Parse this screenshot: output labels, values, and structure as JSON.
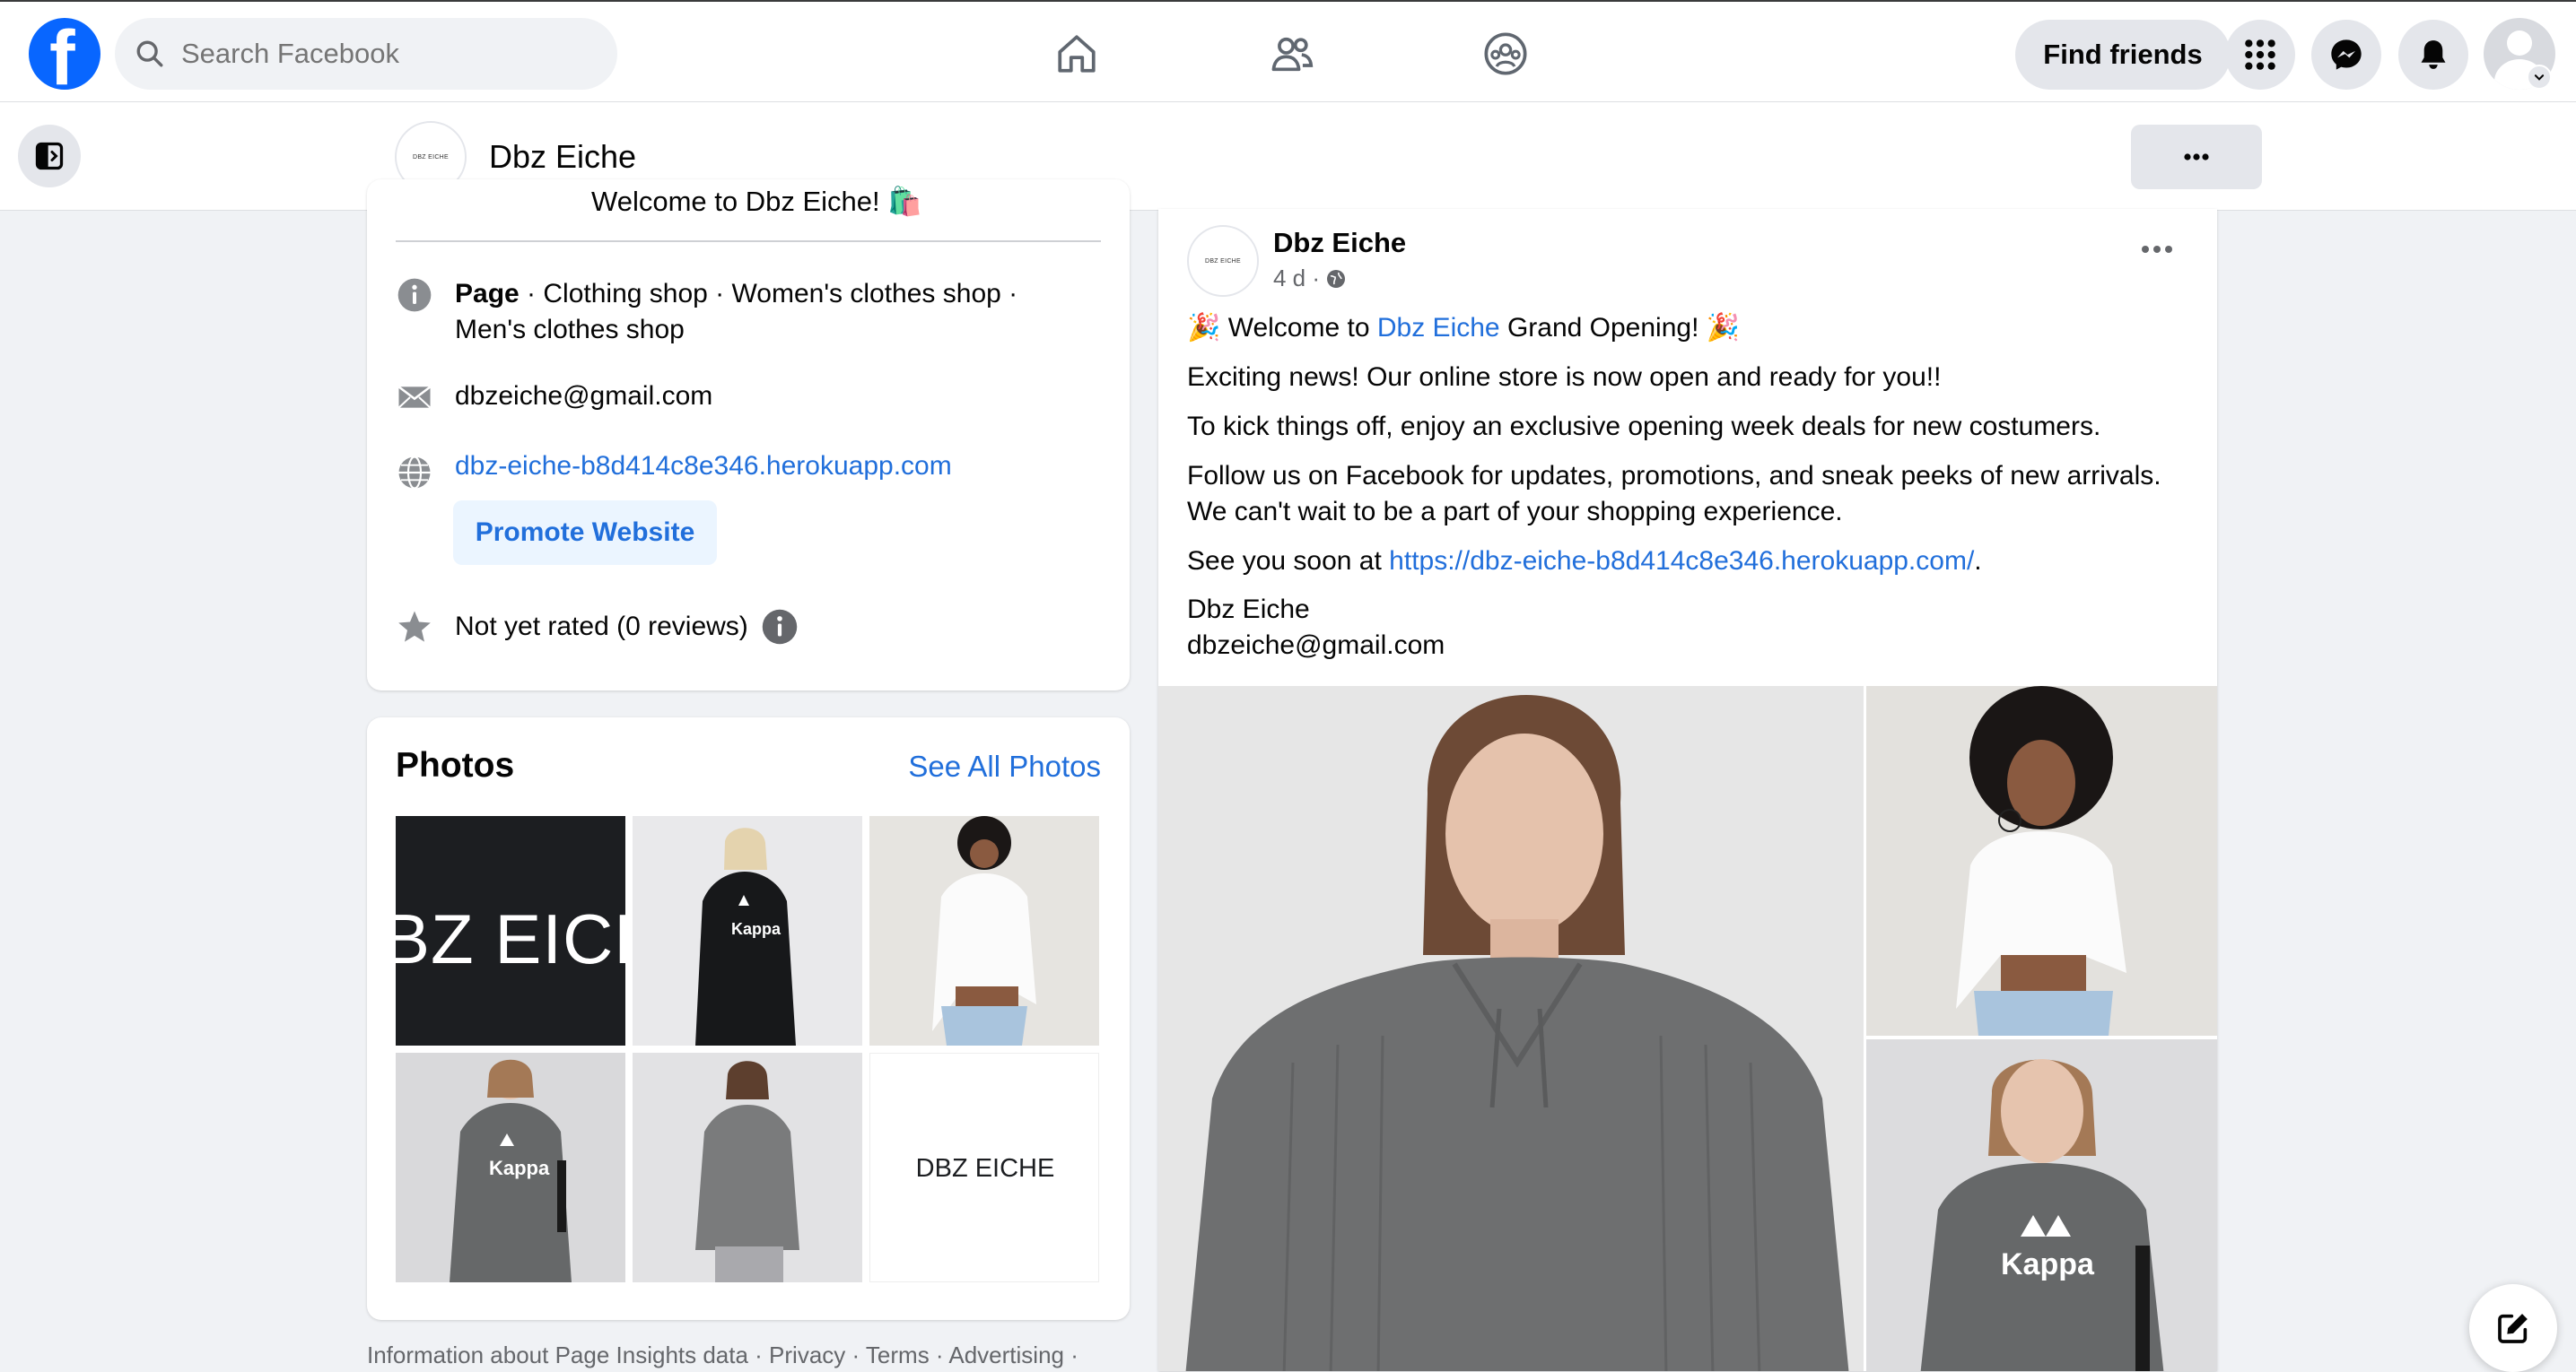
{
  "topnav": {
    "search_placeholder": "Search Facebook",
    "find_friends_label": "Find friends",
    "brand_color": "#0866ff"
  },
  "pagebar": {
    "page_name": "Dbz Eiche",
    "avatar_logo_text": "DBZ EICHE"
  },
  "intro": {
    "clipped_text": "Welcome to Dbz Eiche! 🛍️",
    "category_label": "Page",
    "categories_line1": " · Clothing shop · Women's clothes shop ·",
    "categories_line2": "Men's clothes shop",
    "email": "dbzeiche@gmail.com",
    "website": "dbz-eiche-b8d414c8e346.herokuapp.com",
    "promote_label": "Promote Website",
    "rating": "Not yet rated (0 reviews)"
  },
  "photos": {
    "title": "Photos",
    "see_all": "See All Photos",
    "logo_tile_text": "BZ EICH",
    "logo_tile2_text": "DBZ EICHE"
  },
  "footer": {
    "links": "Information about Page Insights data · Privacy · Terms · Advertising ·"
  },
  "post": {
    "author": "Dbz Eiche",
    "time": "4 d ·",
    "line1_pre": "🎉 Welcome to ",
    "line1_link": "Dbz Eiche",
    "line1_post": " Grand Opening! 🎉",
    "line2": "Exciting news! Our online store is now open and ready for you!!",
    "line3": "To kick things off, enjoy an exclusive opening week deals for new costumers.",
    "line4": "Follow us on Facebook for updates, promotions, and sneak peeks of new arrivals.",
    "line5": "We can't wait to be a part of your shopping experience.",
    "line6_pre": "See you soon at ",
    "line6_link": "https://dbz-eiche-b8d414c8e346.herokuapp.com/",
    "line6_post": ".",
    "signature_link": "Dbz Eiche",
    "signature_email": "dbzeiche@gmail.com"
  }
}
